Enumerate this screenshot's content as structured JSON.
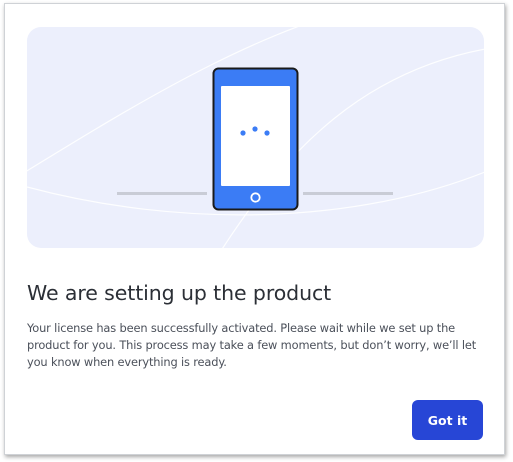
{
  "dialog": {
    "title": "We are setting up the product",
    "description": "Your license has been successfully activated. Please wait while we set up the product for you. This process may take a few moments, but don’t worry, we’ll let you know when everything is ready.",
    "primary_button_label": "Got it"
  },
  "illustration": {
    "icon": "smartphone-loading-icon",
    "background_color": "#eceffc",
    "phone_color": "#3b7cf5",
    "phone_outline_color": "#1a1a1a",
    "screen_color": "#ffffff"
  },
  "colors": {
    "title_text": "#2b2f36",
    "body_text": "#4b505a",
    "button_background": "#2746d6",
    "button_text": "#ffffff"
  }
}
